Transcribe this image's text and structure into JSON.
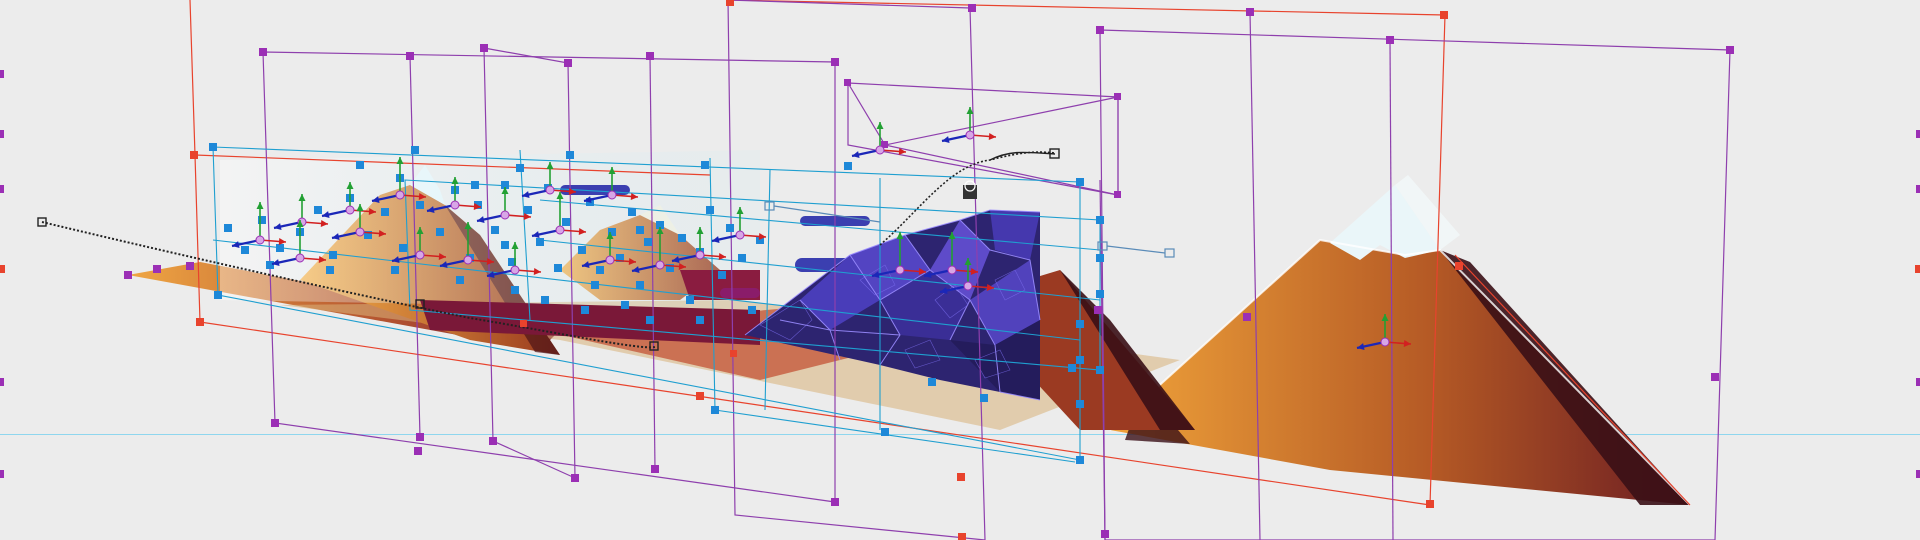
{
  "viewport": {
    "background": "#ececec",
    "guide_color": "#8fd6ee"
  },
  "colors": {
    "outer_frame": "#e8432d",
    "layer_frame": "#8e3fad",
    "selection_cyan": "#1f9fd0",
    "handle_blue": "#1e88d8",
    "handle_red": "#e8432d",
    "handle_purple": "#9b2fb5",
    "gizmo_x": "#d22020",
    "gizmo_y": "#22a033",
    "gizmo_z": "#1b27b8",
    "mountain_light": "#f0a33a",
    "mountain_dark": "#7a2318",
    "mountain_shadow": "#3a0f16",
    "snow": "#dff2f6",
    "crystal_fill": "#2d2470",
    "crystal_light": "#6a55e0",
    "crystal_edge": "#9a8cff"
  },
  "scene": {
    "layers": [
      {
        "name": "mountain-back-left"
      },
      {
        "name": "mountain-big-right"
      },
      {
        "name": "crystal-wall"
      },
      {
        "name": "ground-plane"
      },
      {
        "name": "camera-rig"
      }
    ],
    "tools": [
      "move-gizmo",
      "path-curve",
      "null-object"
    ]
  }
}
